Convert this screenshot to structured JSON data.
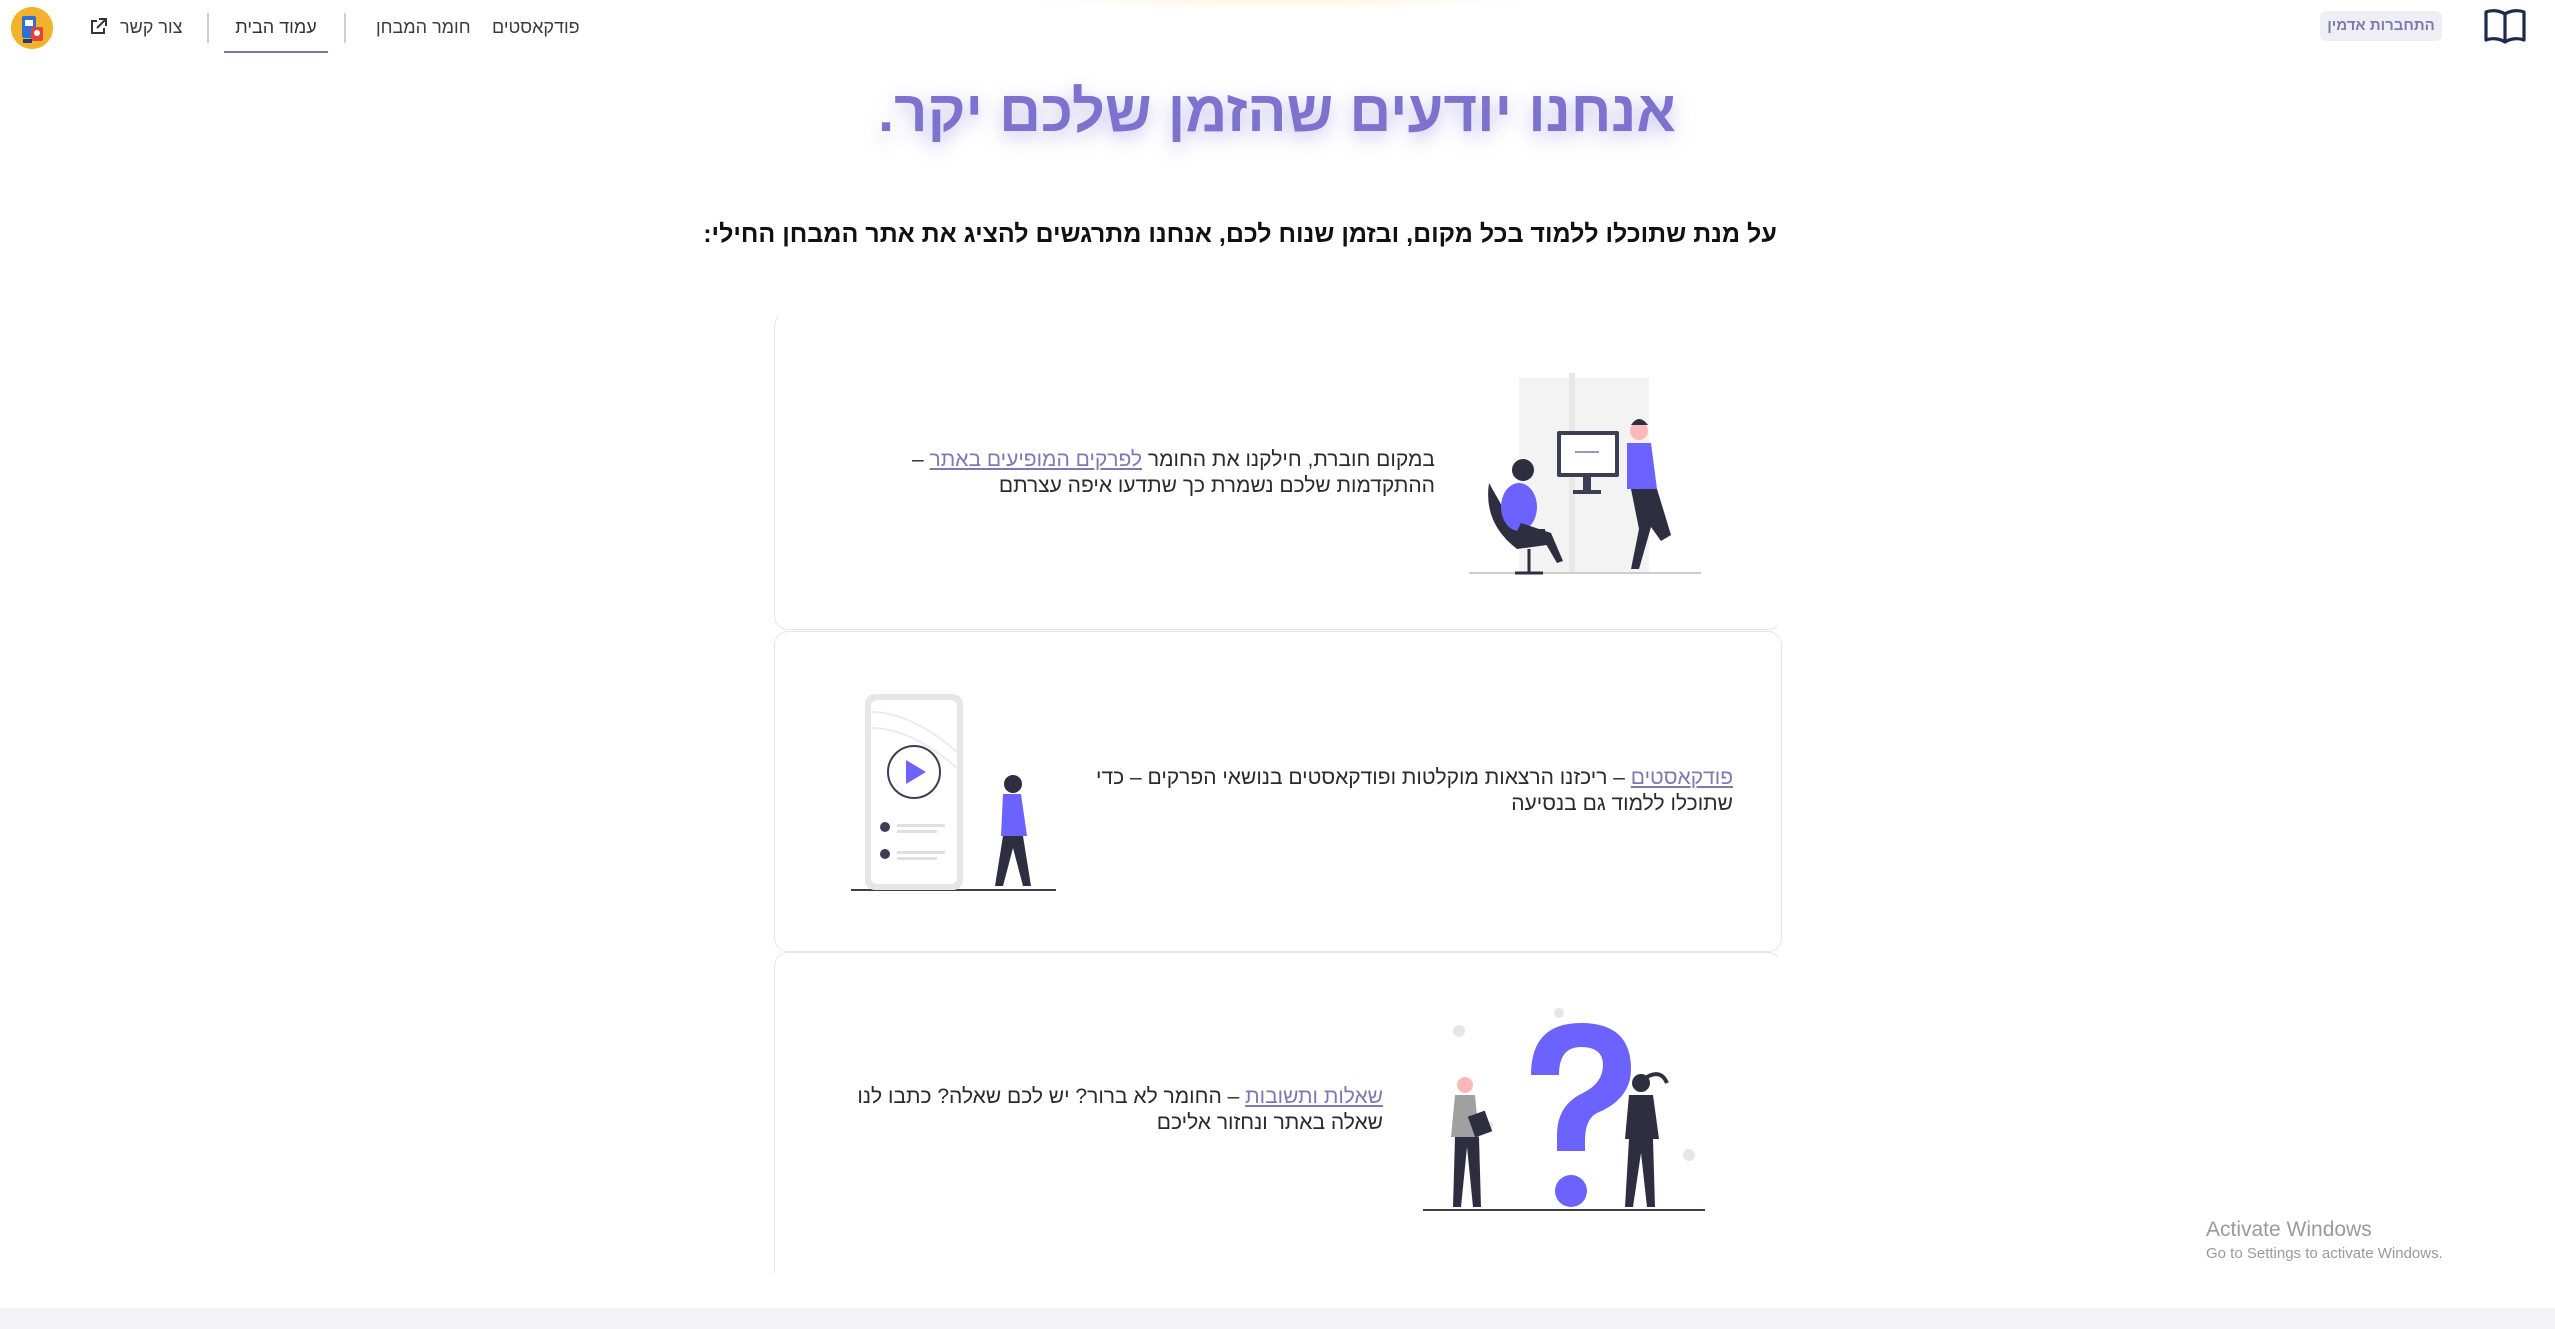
{
  "nav": {
    "contact_label": "צור קשר",
    "home_label": "עמוד הבית",
    "material_label": "חומר המבחן",
    "podcasts_label": "פודקאסטים",
    "admin_login_label": "התחברות אדמין",
    "accent_color": "#7d73cf"
  },
  "hero": {
    "title": "אנחנו יודעים שהזמן שלכם יקר.",
    "subtitle": "על מנת שתוכלו ללמוד בכל מקום, ובזמן שנוח לכם, אנחנו מתרגשים להציג את אתר המבחן החילי:"
  },
  "cards": [
    {
      "text_before": "במקום חוברת, חילקנו את החומר ",
      "link": "לפרקים המופיעים באתר",
      "text_after": " – ההתקדמות שלכם נשמרת כך שתדעו איפה עצרתם",
      "illustration": "desk-computer-illustration"
    },
    {
      "text_before": "",
      "link": "פודקאסטים",
      "text_after": " – ריכזנו הרצאות מוקלטות ופודקאסטים בנושאי הפרקים – כדי שתוכלו ללמוד גם בנסיעה",
      "illustration": "phone-play-illustration"
    },
    {
      "text_before": "",
      "link": "שאלות ותשובות",
      "text_after": " – החומר לא ברור? יש לכם שאלה? כתבו לנו שאלה באתר ונחזור אליכם",
      "illustration": "question-mark-illustration"
    }
  ],
  "watermark": {
    "line1": "Activate Windows",
    "line2": "Go to Settings to activate Windows."
  }
}
